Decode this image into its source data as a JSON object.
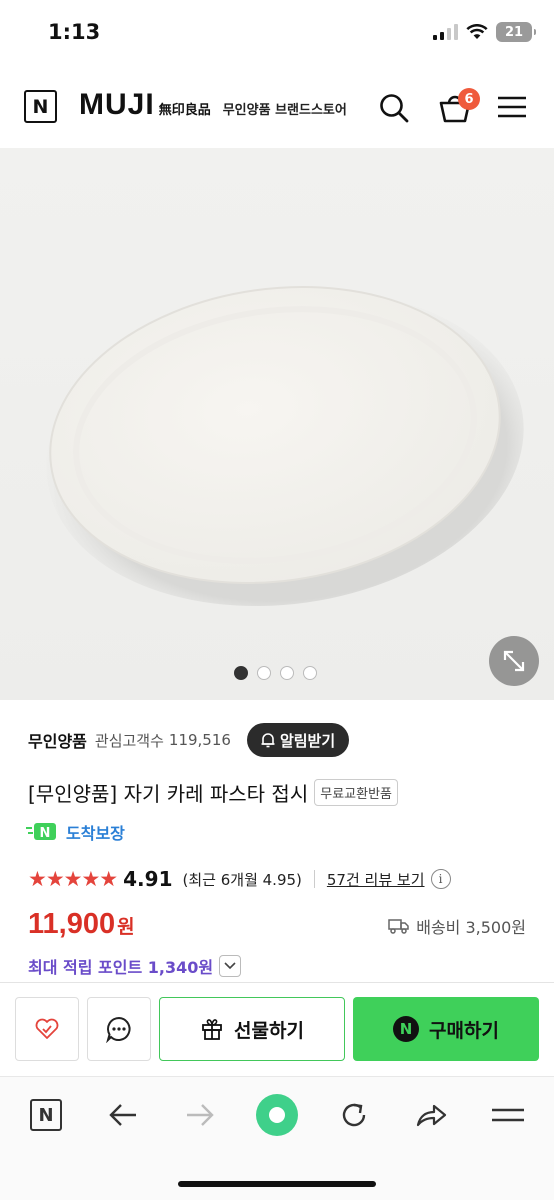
{
  "status_bar": {
    "time": "1:13",
    "battery": "21"
  },
  "header": {
    "logo_letter": "N",
    "brand": "MUJI",
    "brand_kanji": "無印良品",
    "store_title": "무인양품 브랜드스토어",
    "cart_count": "6",
    "icons": [
      "search-icon",
      "cart-icon",
      "menu-icon"
    ]
  },
  "gallery": {
    "image_count": 4,
    "active_index": 0,
    "image_subject": "white oval plate"
  },
  "product": {
    "store_name": "무인양품",
    "follower_label": "관심고객수",
    "follower_count": "119,516",
    "alarm_label": "알림받기",
    "title": "[무인양품] 자기 카레 파스타 접시",
    "tag": "무료교환반품",
    "delivery_badge": "N",
    "delivery_label": "도착보장",
    "stars": "★★★★★",
    "rating": "4.91",
    "recent_rating": "(최근 6개월 4.95)",
    "review_link": "57건 리뷰 보기",
    "price": "11,900",
    "currency": "원",
    "shipping": "배송비 3,500원",
    "points": "최대 적립 포인트 1,340원"
  },
  "actions": {
    "gift_label": "선물하기",
    "buy_label": "구매하기",
    "buy_badge": "N"
  },
  "browser": {
    "home_letter": "N"
  },
  "colors": {
    "price_red": "#d93026",
    "naver_green": "#3fd05a",
    "points_purple": "#6a4cc9",
    "delivery_blue": "#2a7fd6",
    "star_red": "#e4443c"
  }
}
